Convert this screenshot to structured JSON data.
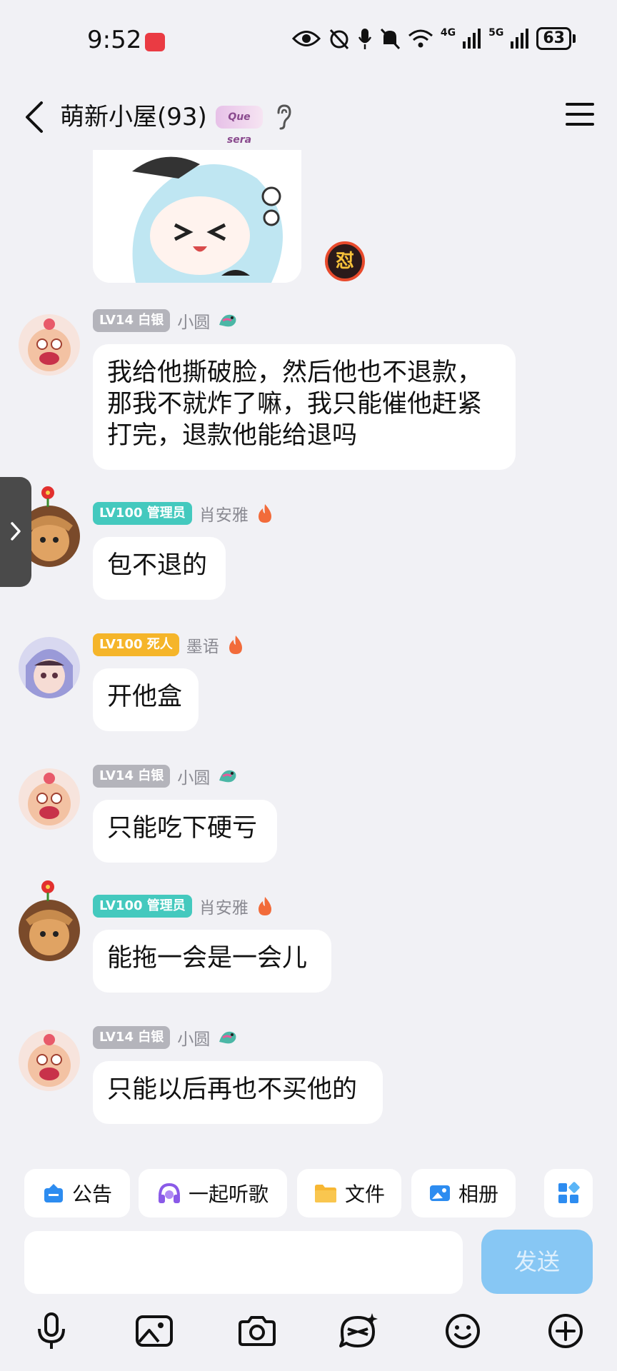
{
  "status_bar": {
    "time": "9:52",
    "battery": "63",
    "network_a": "4G",
    "network_b": "5G"
  },
  "header": {
    "title": "萌新小屋(93)",
    "tag": "Que sera"
  },
  "sticker_reaction": "怼",
  "messages": [
    {
      "level": "LV14 白银",
      "level_color": "#b4b4bb",
      "name": "小圆",
      "text": [
        "我给他撕破脸，然后他也不退款，",
        "那我不就炸了嘛，我只能催他赶紧",
        "打完，退款他能给退吗"
      ]
    },
    {
      "level": "LV100 管理员",
      "level_color": "#44c9be",
      "name": "肖安雅",
      "text": [
        "包不退的"
      ]
    },
    {
      "level": "LV100 死人",
      "level_color": "#f5b52a",
      "name": "墨语",
      "text": [
        "开他盒"
      ]
    },
    {
      "level": "LV14 白银",
      "level_color": "#b4b4bb",
      "name": "小圆",
      "text": [
        "只能吃下硬亏"
      ]
    },
    {
      "level": "LV100 管理员",
      "level_color": "#44c9be",
      "name": "肖安雅",
      "text": [
        "能拖一会是一会儿"
      ]
    },
    {
      "level": "LV14 白银",
      "level_color": "#b4b4bb",
      "name": "小圆",
      "text": [
        "只能以后再也不买他的"
      ]
    }
  ],
  "quick_actions": {
    "notice": "公告",
    "listen": "一起听歌",
    "files": "文件",
    "album": "相册"
  },
  "composer": {
    "placeholder": "",
    "send_label": "发送"
  },
  "toolbar_icons": [
    "microphone-icon",
    "image-icon",
    "camera-icon",
    "sticker-icon",
    "emoji-icon",
    "plus-icon"
  ]
}
